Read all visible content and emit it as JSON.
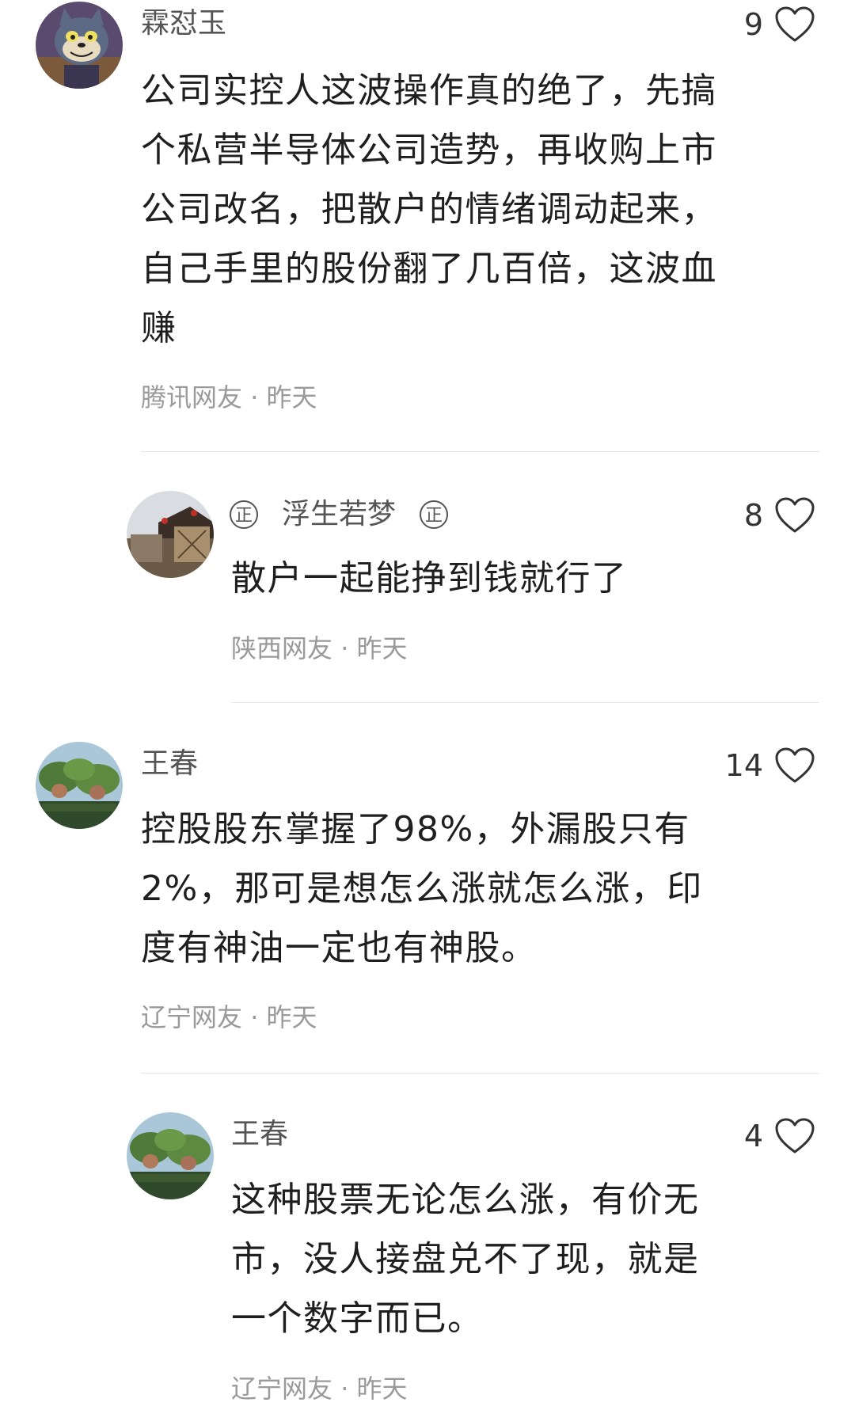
{
  "comments": [
    {
      "user": "霖怼玉",
      "likes": "9",
      "lines": [
        "公司实控人这波操作真的绝了，先搞",
        "个私营半导体公司造势，再收购上市",
        "公司改名，把散户的情绪调动起来，",
        "自己手里的股份翻了几百倍，这波血",
        "赚"
      ],
      "location": "腾讯网友",
      "time": "昨天"
    },
    {
      "badge_left": "正",
      "user": "浮生若梦",
      "badge_right": "正",
      "likes": "8",
      "lines": [
        "散户一起能挣到钱就行了"
      ],
      "location": "陕西网友",
      "time": "昨天"
    },
    {
      "user": "王春",
      "likes": "14",
      "lines": [
        "控股股东掌握了98%，外漏股只有",
        "2%，那可是想怎么涨就怎么涨，印",
        "度有神油一定也有神股。"
      ],
      "location": "辽宁网友",
      "time": "昨天"
    },
    {
      "user": "王春",
      "likes": "4",
      "lines": [
        "这种股票无论怎么涨，有价无",
        "市，没人接盘兑不了现，就是",
        "一个数字而已。"
      ],
      "location": "辽宁网友",
      "time": "昨天"
    }
  ],
  "separator": "·",
  "icons": {
    "like": "heart-outline-icon"
  },
  "colors": {
    "text": "#1f1f1f",
    "name": "#555555",
    "meta": "#9a9a9a",
    "divider": "#e6e6e6"
  }
}
